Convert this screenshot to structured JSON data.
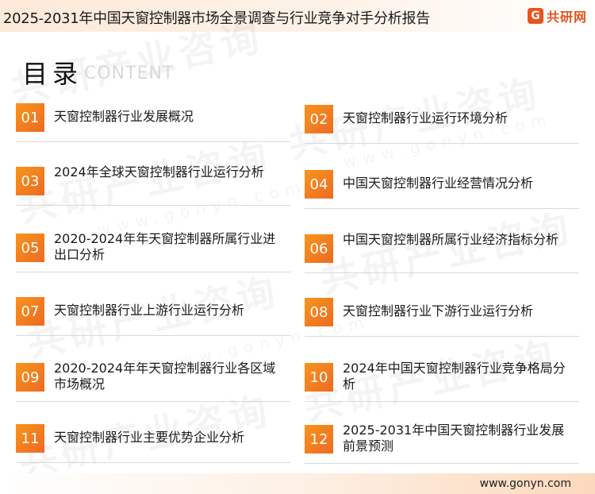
{
  "header": {
    "title": "2025-2031年中国天窗控制器市场全景调查与行业竞争对手分析报告",
    "brand_mark": "G",
    "brand_name": "共研网"
  },
  "watermark": {
    "text": "共研产业咨询",
    "sub": "www.gonyn.com"
  },
  "toc": {
    "title": "目录",
    "subtitle": "CONTENT",
    "items": [
      {
        "num": "01",
        "label": "天窗控制器行业发展概况"
      },
      {
        "num": "02",
        "label": "天窗控制器行业运行环境分析"
      },
      {
        "num": "03",
        "label": "2024年全球天窗控制器行业运行分析"
      },
      {
        "num": "04",
        "label": "中国天窗控制器行业经营情况分析"
      },
      {
        "num": "05",
        "label": "2020-2024年年天窗控制器所属行业进出口分析"
      },
      {
        "num": "06",
        "label": "中国天窗控制器所属行业经济指标分析"
      },
      {
        "num": "07",
        "label": "天窗控制器行业上游行业运行分析"
      },
      {
        "num": "08",
        "label": "天窗控制器行业下游行业运行分析"
      },
      {
        "num": "09",
        "label": "2020-2024年年天窗控制器行业各区域市场概况"
      },
      {
        "num": "10",
        "label": "2024年中国天窗控制器行业竞争格局分析"
      },
      {
        "num": "11",
        "label": "天窗控制器行业主要优势企业分析"
      },
      {
        "num": "12",
        "label": "2025-2031年中国天窗控制器行业发展前景预测"
      }
    ]
  },
  "footer": {
    "url": "www.gonyn.com"
  },
  "colors": {
    "accent": "#ee6a22",
    "accent_light": "#f7941d",
    "brand": "#e8531e"
  }
}
